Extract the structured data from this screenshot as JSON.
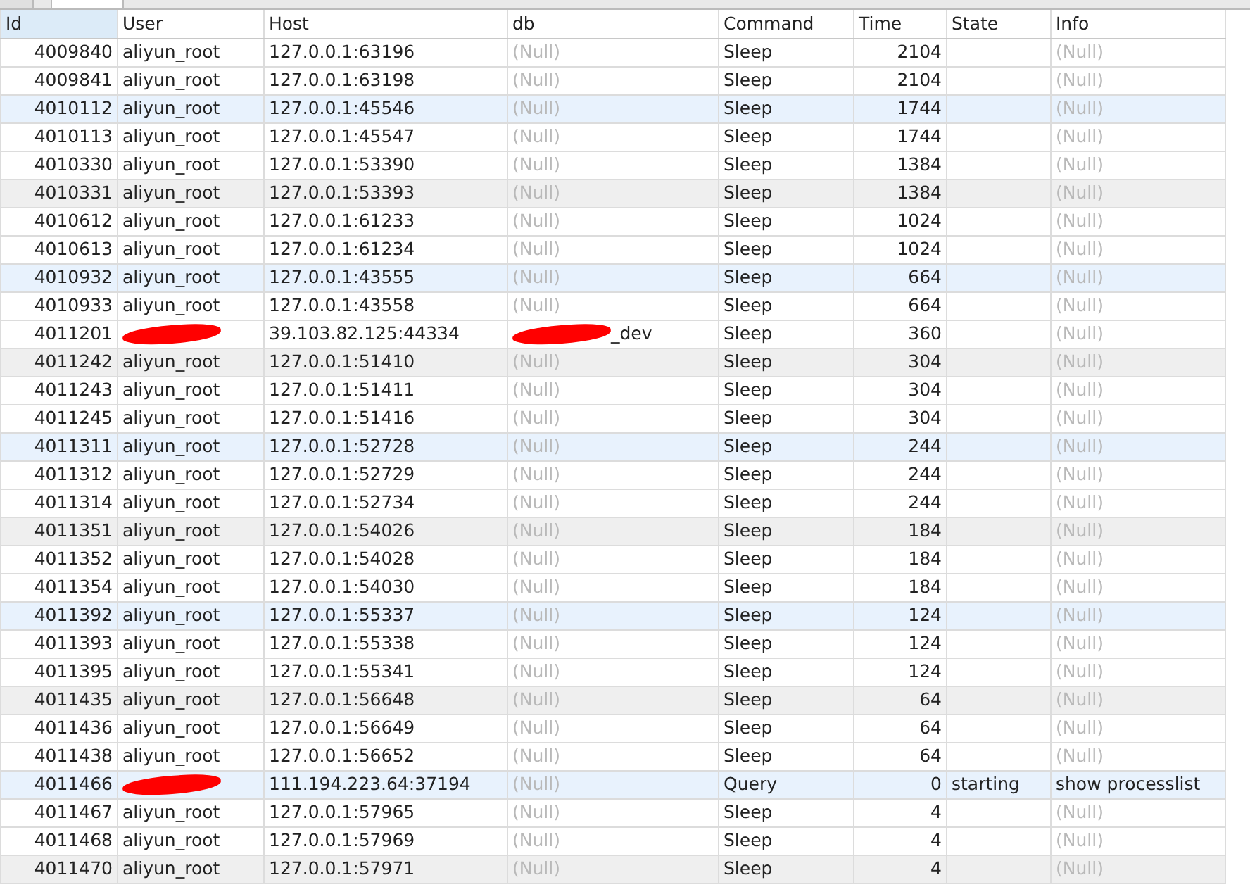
{
  "tabs": [
    {
      "selected": false
    },
    {
      "selected": true
    }
  ],
  "table": {
    "columns": [
      {
        "label": "Id",
        "kind": "number",
        "selected": true
      },
      {
        "label": "User",
        "kind": "text",
        "selected": false
      },
      {
        "label": "Host",
        "kind": "text",
        "selected": false
      },
      {
        "label": "db",
        "kind": "text",
        "selected": false
      },
      {
        "label": "Command",
        "kind": "text",
        "selected": false
      },
      {
        "label": "Time",
        "kind": "number",
        "selected": false
      },
      {
        "label": "State",
        "kind": "text",
        "selected": false
      },
      {
        "label": "Info",
        "kind": "text",
        "selected": false
      }
    ],
    "rows": [
      [
        "4009840",
        "aliyun_root",
        "127.0.0.1:63196",
        {
          "text": "(Null)",
          "is_null": true
        },
        "Sleep",
        "2104",
        "",
        {
          "text": "(Null)",
          "is_null": true
        }
      ],
      [
        "4009841",
        "aliyun_root",
        "127.0.0.1:63198",
        {
          "text": "(Null)",
          "is_null": true
        },
        "Sleep",
        "2104",
        "",
        {
          "text": "(Null)",
          "is_null": true
        }
      ],
      [
        "4010112",
        "aliyun_root",
        "127.0.0.1:45546",
        {
          "text": "(Null)",
          "is_null": true
        },
        "Sleep",
        "1744",
        "",
        {
          "text": "(Null)",
          "is_null": true
        }
      ],
      [
        "4010113",
        "aliyun_root",
        "127.0.0.1:45547",
        {
          "text": "(Null)",
          "is_null": true
        },
        "Sleep",
        "1744",
        "",
        {
          "text": "(Null)",
          "is_null": true
        }
      ],
      [
        "4010330",
        "aliyun_root",
        "127.0.0.1:53390",
        {
          "text": "(Null)",
          "is_null": true
        },
        "Sleep",
        "1384",
        "",
        {
          "text": "(Null)",
          "is_null": true
        }
      ],
      [
        "4010331",
        "aliyun_root",
        "127.0.0.1:53393",
        {
          "text": "(Null)",
          "is_null": true
        },
        "Sleep",
        "1384",
        "",
        {
          "text": "(Null)",
          "is_null": true
        }
      ],
      [
        "4010612",
        "aliyun_root",
        "127.0.0.1:61233",
        {
          "text": "(Null)",
          "is_null": true
        },
        "Sleep",
        "1024",
        "",
        {
          "text": "(Null)",
          "is_null": true
        }
      ],
      [
        "4010613",
        "aliyun_root",
        "127.0.0.1:61234",
        {
          "text": "(Null)",
          "is_null": true
        },
        "Sleep",
        "1024",
        "",
        {
          "text": "(Null)",
          "is_null": true
        }
      ],
      [
        "4010932",
        "aliyun_root",
        "127.0.0.1:43555",
        {
          "text": "(Null)",
          "is_null": true
        },
        "Sleep",
        "664",
        "",
        {
          "text": "(Null)",
          "is_null": true
        }
      ],
      [
        "4010933",
        "aliyun_root",
        "127.0.0.1:43558",
        {
          "text": "(Null)",
          "is_null": true
        },
        "Sleep",
        "664",
        "",
        {
          "text": "(Null)",
          "is_null": true
        }
      ],
      [
        "4011201",
        {
          "redacted": true
        },
        "39.103.82.125:44334",
        {
          "text": "_dev",
          "redacted": true
        },
        "Sleep",
        "360",
        "",
        {
          "text": "(Null)",
          "is_null": true
        }
      ],
      [
        "4011242",
        "aliyun_root",
        "127.0.0.1:51410",
        {
          "text": "(Null)",
          "is_null": true
        },
        "Sleep",
        "304",
        "",
        {
          "text": "(Null)",
          "is_null": true
        }
      ],
      [
        "4011243",
        "aliyun_root",
        "127.0.0.1:51411",
        {
          "text": "(Null)",
          "is_null": true
        },
        "Sleep",
        "304",
        "",
        {
          "text": "(Null)",
          "is_null": true
        }
      ],
      [
        "4011245",
        "aliyun_root",
        "127.0.0.1:51416",
        {
          "text": "(Null)",
          "is_null": true
        },
        "Sleep",
        "304",
        "",
        {
          "text": "(Null)",
          "is_null": true
        }
      ],
      [
        "4011311",
        "aliyun_root",
        "127.0.0.1:52728",
        {
          "text": "(Null)",
          "is_null": true
        },
        "Sleep",
        "244",
        "",
        {
          "text": "(Null)",
          "is_null": true
        }
      ],
      [
        "4011312",
        "aliyun_root",
        "127.0.0.1:52729",
        {
          "text": "(Null)",
          "is_null": true
        },
        "Sleep",
        "244",
        "",
        {
          "text": "(Null)",
          "is_null": true
        }
      ],
      [
        "4011314",
        "aliyun_root",
        "127.0.0.1:52734",
        {
          "text": "(Null)",
          "is_null": true
        },
        "Sleep",
        "244",
        "",
        {
          "text": "(Null)",
          "is_null": true
        }
      ],
      [
        "4011351",
        "aliyun_root",
        "127.0.0.1:54026",
        {
          "text": "(Null)",
          "is_null": true
        },
        "Sleep",
        "184",
        "",
        {
          "text": "(Null)",
          "is_null": true
        }
      ],
      [
        "4011352",
        "aliyun_root",
        "127.0.0.1:54028",
        {
          "text": "(Null)",
          "is_null": true
        },
        "Sleep",
        "184",
        "",
        {
          "text": "(Null)",
          "is_null": true
        }
      ],
      [
        "4011354",
        "aliyun_root",
        "127.0.0.1:54030",
        {
          "text": "(Null)",
          "is_null": true
        },
        "Sleep",
        "184",
        "",
        {
          "text": "(Null)",
          "is_null": true
        }
      ],
      [
        "4011392",
        "aliyun_root",
        "127.0.0.1:55337",
        {
          "text": "(Null)",
          "is_null": true
        },
        "Sleep",
        "124",
        "",
        {
          "text": "(Null)",
          "is_null": true
        }
      ],
      [
        "4011393",
        "aliyun_root",
        "127.0.0.1:55338",
        {
          "text": "(Null)",
          "is_null": true
        },
        "Sleep",
        "124",
        "",
        {
          "text": "(Null)",
          "is_null": true
        }
      ],
      [
        "4011395",
        "aliyun_root",
        "127.0.0.1:55341",
        {
          "text": "(Null)",
          "is_null": true
        },
        "Sleep",
        "124",
        "",
        {
          "text": "(Null)",
          "is_null": true
        }
      ],
      [
        "4011435",
        "aliyun_root",
        "127.0.0.1:56648",
        {
          "text": "(Null)",
          "is_null": true
        },
        "Sleep",
        "64",
        "",
        {
          "text": "(Null)",
          "is_null": true
        }
      ],
      [
        "4011436",
        "aliyun_root",
        "127.0.0.1:56649",
        {
          "text": "(Null)",
          "is_null": true
        },
        "Sleep",
        "64",
        "",
        {
          "text": "(Null)",
          "is_null": true
        }
      ],
      [
        "4011438",
        "aliyun_root",
        "127.0.0.1:56652",
        {
          "text": "(Null)",
          "is_null": true
        },
        "Sleep",
        "64",
        "",
        {
          "text": "(Null)",
          "is_null": true
        }
      ],
      [
        "4011466",
        {
          "redacted": true
        },
        "111.194.223.64:37194",
        {
          "text": "(Null)",
          "is_null": true
        },
        "Query",
        "0",
        "starting",
        "show processlist"
      ],
      [
        "4011467",
        "aliyun_root",
        "127.0.0.1:57965",
        {
          "text": "(Null)",
          "is_null": true
        },
        "Sleep",
        "4",
        "",
        {
          "text": "(Null)",
          "is_null": true
        }
      ],
      [
        "4011468",
        "aliyun_root",
        "127.0.0.1:57969",
        {
          "text": "(Null)",
          "is_null": true
        },
        "Sleep",
        "4",
        "",
        {
          "text": "(Null)",
          "is_null": true
        }
      ],
      [
        "4011470",
        "aliyun_root",
        "127.0.0.1:57971",
        {
          "text": "(Null)",
          "is_null": true
        },
        "Sleep",
        "4",
        "",
        {
          "text": "(Null)",
          "is_null": true
        }
      ]
    ]
  }
}
